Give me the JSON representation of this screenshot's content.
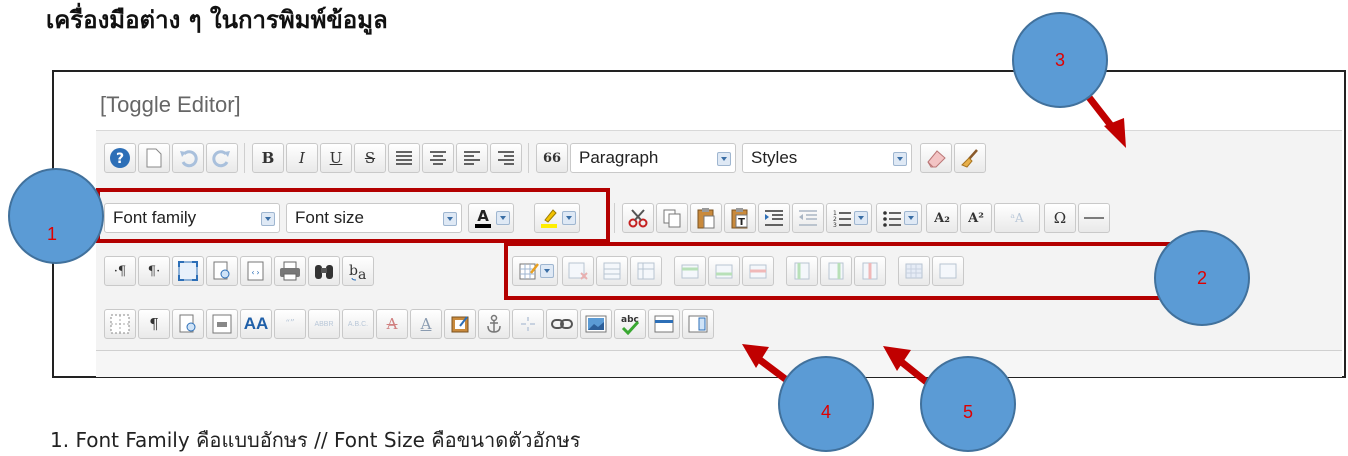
{
  "heading": "เครื่องมือต่าง ๆ ในการพิมพ์ข้อมูล",
  "editor": {
    "toggle_label": "[Toggle Editor]",
    "format_select": "Paragraph",
    "styles_select": "Styles",
    "font_family_select": "Font family",
    "font_size_select": "Font size"
  },
  "callouts": {
    "one": "1",
    "two": "2",
    "three": "3",
    "four": "4",
    "five": "5"
  },
  "caption": "1. Font Family คือแบบอักษร // Font Size คือขนาดตัวอักษร",
  "colors": {
    "callout_fill": "#5b9bd5",
    "callout_text": "#e00000",
    "highlight_box": "#b30000",
    "arrow": "#c00000"
  }
}
